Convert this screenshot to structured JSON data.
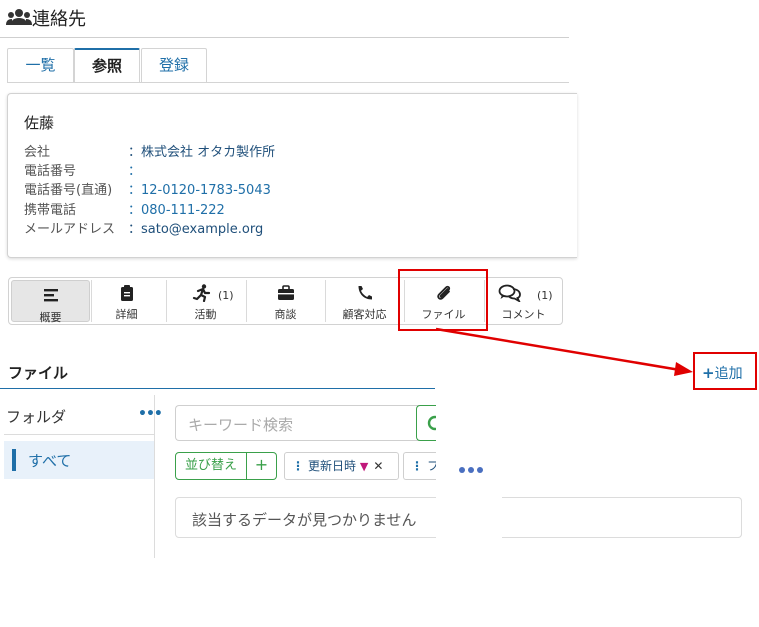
{
  "header": {
    "title": "連絡先",
    "icon": "users-icon"
  },
  "tabs": [
    {
      "label": "一覧",
      "active": false
    },
    {
      "label": "参照",
      "active": true
    },
    {
      "label": "登録",
      "active": false
    }
  ],
  "contact": {
    "name": "佐藤",
    "fields": [
      {
        "label": "会社",
        "value": "：株式会社 オタカ製作所"
      },
      {
        "label": "電話番号",
        "value": "："
      },
      {
        "label": "電話番号(直通)",
        "value": "：12-0120-1783-5043"
      },
      {
        "label": "携帯電話",
        "value": "：080-111-222"
      },
      {
        "label": "メールアドレス",
        "value": "：sato@example.org"
      }
    ]
  },
  "toolbar": {
    "items": [
      {
        "label": "概要",
        "icon": "list-icon",
        "active": true
      },
      {
        "label": "詳細",
        "icon": "clipboard-icon"
      },
      {
        "label": "活動",
        "icon": "running-icon",
        "count": "(1)"
      },
      {
        "label": "商談",
        "icon": "briefcase-icon"
      },
      {
        "label": "顧客対応",
        "icon": "phone-icon"
      },
      {
        "label": "ファイル",
        "icon": "paperclip-icon",
        "highlighted": true
      },
      {
        "label": "コメント",
        "icon": "comments-icon",
        "count": "(1)"
      }
    ]
  },
  "files": {
    "title": "ファイル",
    "add_label": "追加",
    "add_plus": "+",
    "folder_label": "フォルダ",
    "folder_more": "•••",
    "folders": [
      {
        "label": "すべて",
        "selected": true
      }
    ],
    "search_placeholder": "キーワード検索",
    "sort_label": "並び替え",
    "sort_add": "+",
    "sort_chips": [
      {
        "dots": "⋮",
        "label": "更新日時",
        "direction": "▼",
        "remove": "✕"
      },
      {
        "dots": "⋮",
        "label": "フ"
      }
    ],
    "empty_message": "該当するデータが見つかりません"
  },
  "colors": {
    "accent": "#1f6fa8",
    "green": "#3aa04a",
    "highlight": "#e00000"
  }
}
